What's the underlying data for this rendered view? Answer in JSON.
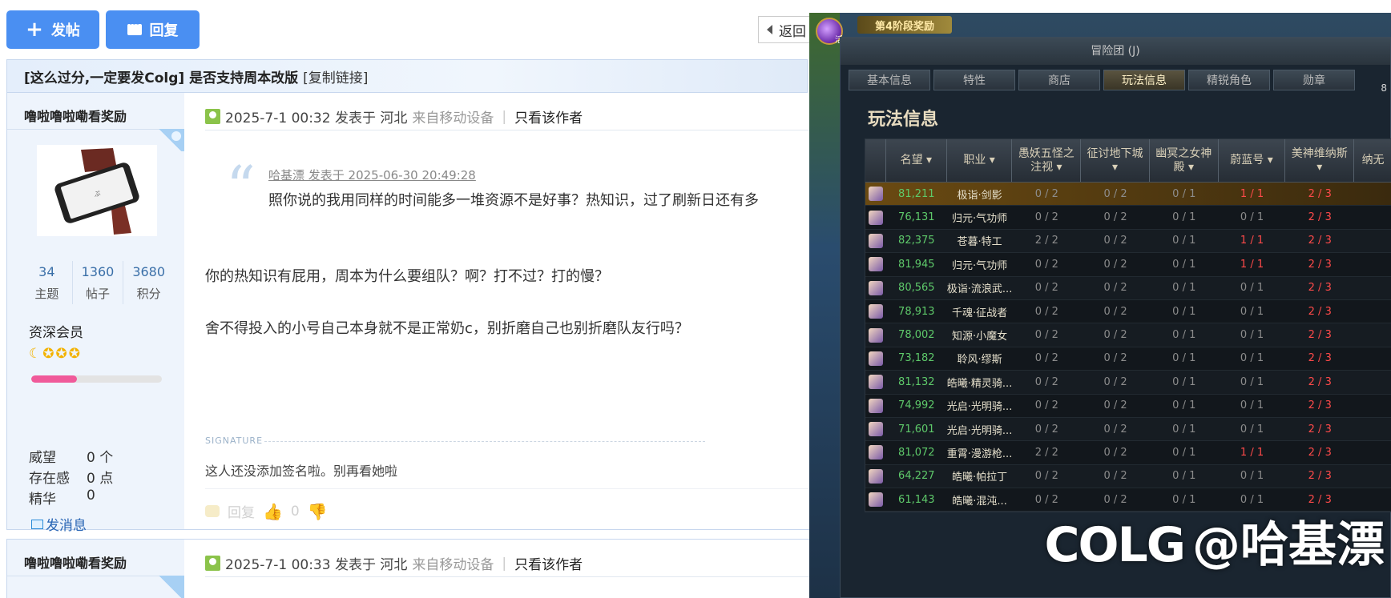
{
  "toolbar": {
    "post_label": "发帖",
    "reply_label": "回复",
    "back_label": "返回"
  },
  "thread": {
    "title": "[这么过分,一定要发Colg] 是否支持周本改版",
    "copy_link": "[复制链接]"
  },
  "post1": {
    "author": "噜啦噜啦嘞看奖励",
    "stats": [
      {
        "num": "34",
        "label": "主题"
      },
      {
        "num": "1360",
        "label": "帖子"
      },
      {
        "num": "3680",
        "label": "积分"
      }
    ],
    "group": "资深会员",
    "level_progress": 0.35,
    "fields": [
      {
        "k": "威望",
        "v": "0 个"
      },
      {
        "k": "存在感",
        "v": "0 点"
      },
      {
        "k": "精华",
        "v": "0"
      }
    ],
    "send_msg": "发消息",
    "meta": {
      "time": "2025-7-1 00:32 发表于 河北",
      "source": "来自移动设备",
      "sep": "|",
      "only_author": "只看该作者"
    },
    "quote_by": "哈基漂 发表于 2025-06-30 20:49:28",
    "quote_text": "照你说的我用同样的时间能多一堆资源不是好事？热知识，过了刷新日还有多",
    "body": [
      "你的热知识有屁用，周本为什么要组队？啊？打不过？打的慢？",
      "舍不得投入的小号自己本身就不是正常奶c，别折磨自己也别折磨队友行吗？"
    ],
    "signature_label": "SIGNATURE",
    "signature": "这人还没添加签名啦。别再看她啦",
    "reply_label": "回复",
    "like_count": "0"
  },
  "post2": {
    "author": "噜啦噜啦嘞看奖励",
    "meta": {
      "time": "2025-7-1 00:33 发表于 河北",
      "source": "来自移动设备",
      "sep": "|",
      "only_author": "只看该作者"
    }
  },
  "game": {
    "stage_badge": "第4阶段奖励",
    "orb_label": "活",
    "window_title": "冒险团 (J)",
    "score_corner": "8",
    "tabs": [
      "基本信息",
      "特性",
      "商店",
      "玩法信息",
      "精锐角色",
      "勋章"
    ],
    "active_tab": 3,
    "panel_title": "玩法信息",
    "columns": [
      "名望 ▾",
      "职业 ▾",
      "愚妖五怪之注视 ▾",
      "征讨地下城 ▾",
      "幽冥之女神殿 ▾",
      "蔚蓝号 ▾",
      "美神维纳斯 ▾",
      "纳无"
    ],
    "rows": [
      [
        "81,211",
        "极诣·剑影",
        "0 / 2",
        "0 / 2",
        "0 / 1",
        "1 / 1",
        "2 / 3",
        ""
      ],
      [
        "76,131",
        "归元·气功师",
        "0 / 2",
        "0 / 2",
        "0 / 1",
        "0 / 1",
        "2 / 3",
        ""
      ],
      [
        "82,375",
        "苍暮·特工",
        "2 / 2",
        "0 / 2",
        "0 / 1",
        "1 / 1",
        "2 / 3",
        ""
      ],
      [
        "81,945",
        "归元·气功师",
        "0 / 2",
        "0 / 2",
        "0 / 1",
        "1 / 1",
        "2 / 3",
        ""
      ],
      [
        "80,565",
        "极诣·流浪武...",
        "0 / 2",
        "0 / 2",
        "0 / 1",
        "0 / 1",
        "2 / 3",
        ""
      ],
      [
        "78,913",
        "千魂·征战者",
        "0 / 2",
        "0 / 2",
        "0 / 1",
        "0 / 1",
        "2 / 3",
        ""
      ],
      [
        "78,002",
        "知源·小魔女",
        "0 / 2",
        "0 / 2",
        "0 / 1",
        "0 / 1",
        "2 / 3",
        ""
      ],
      [
        "73,182",
        "聆风·缪斯",
        "0 / 2",
        "0 / 2",
        "0 / 1",
        "0 / 1",
        "2 / 3",
        ""
      ],
      [
        "81,132",
        "皓曦·精灵骑...",
        "0 / 2",
        "0 / 2",
        "0 / 1",
        "0 / 1",
        "2 / 3",
        ""
      ],
      [
        "74,992",
        "光启·光明骑...",
        "0 / 2",
        "0 / 2",
        "0 / 1",
        "0 / 1",
        "2 / 3",
        ""
      ],
      [
        "71,601",
        "光启·光明骑...",
        "0 / 2",
        "0 / 2",
        "0 / 1",
        "0 / 1",
        "2 / 3",
        ""
      ],
      [
        "81,072",
        "重霄·漫游枪...",
        "2 / 2",
        "0 / 2",
        "0 / 1",
        "1 / 1",
        "2 / 3",
        ""
      ],
      [
        "64,227",
        "皓曦·帕拉丁",
        "0 / 2",
        "0 / 2",
        "0 / 1",
        "0 / 1",
        "2 / 3",
        ""
      ],
      [
        "61,143",
        "皓曦·混沌...",
        "0 / 2",
        "0 / 2",
        "0 / 1",
        "0 / 1",
        "2 / 3",
        ""
      ]
    ],
    "highlight_row": 0,
    "watermark_logo": "COLG",
    "watermark_text": "@哈基漂"
  }
}
